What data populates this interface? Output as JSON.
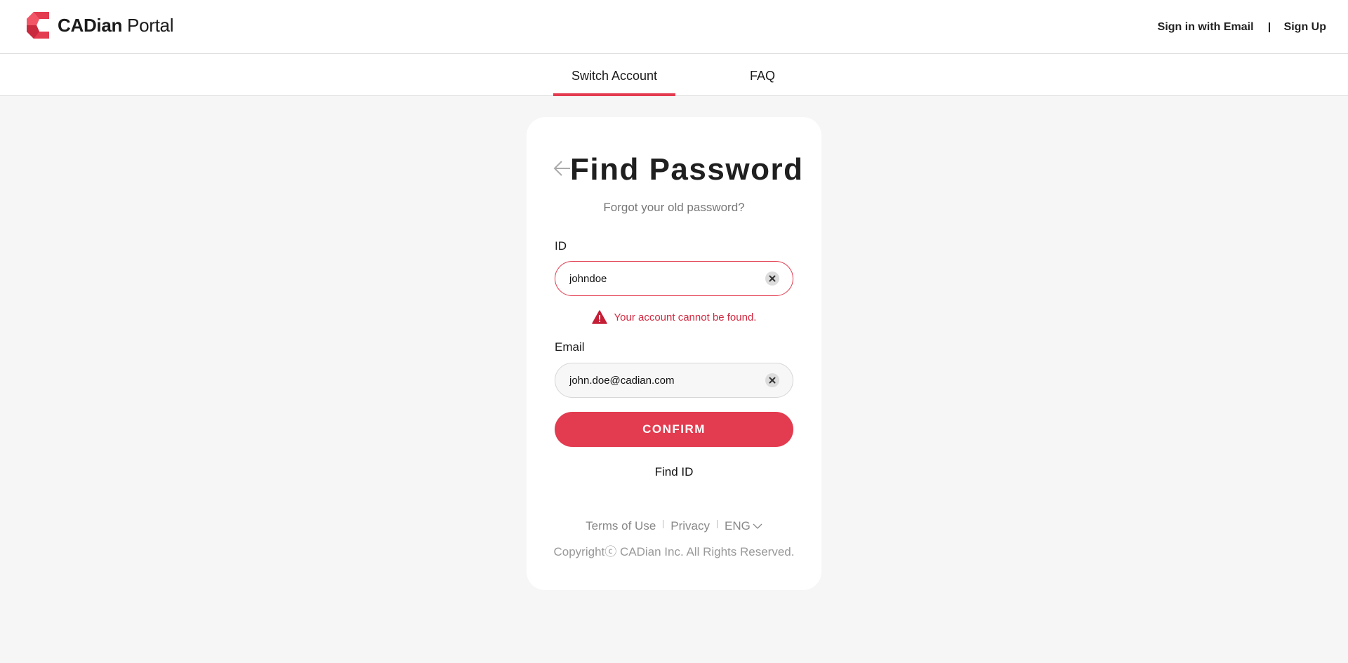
{
  "header": {
    "logo_brand": "CADian",
    "logo_suffix": "Portal",
    "brand_color": "#e33b4f",
    "links": {
      "sign_in": "Sign in with Email",
      "sign_up": "Sign Up"
    }
  },
  "tabs": [
    {
      "label": "Switch Account",
      "active": true
    },
    {
      "label": "FAQ",
      "active": false
    }
  ],
  "form": {
    "title": "Find Password",
    "subtitle": "Forgot your old password?",
    "back_icon": "arrow-left-icon",
    "id_field": {
      "label": "ID",
      "value": "johndoe",
      "clear_icon": "clear-icon",
      "state": "error"
    },
    "error_message": {
      "icon": "warning-icon",
      "text": "Your account cannot be found.",
      "color": "#d12a41"
    },
    "email_field": {
      "label": "Email",
      "value": "john.doe@cadian.com",
      "clear_icon": "clear-icon"
    },
    "confirm_label": "CONFIRM",
    "find_id_label": "Find ID"
  },
  "footer": {
    "terms": "Terms of Use",
    "privacy": "Privacy",
    "language": "ENG",
    "copyright": "Copyrightⓒ CADian Inc. All Rights Reserved."
  }
}
